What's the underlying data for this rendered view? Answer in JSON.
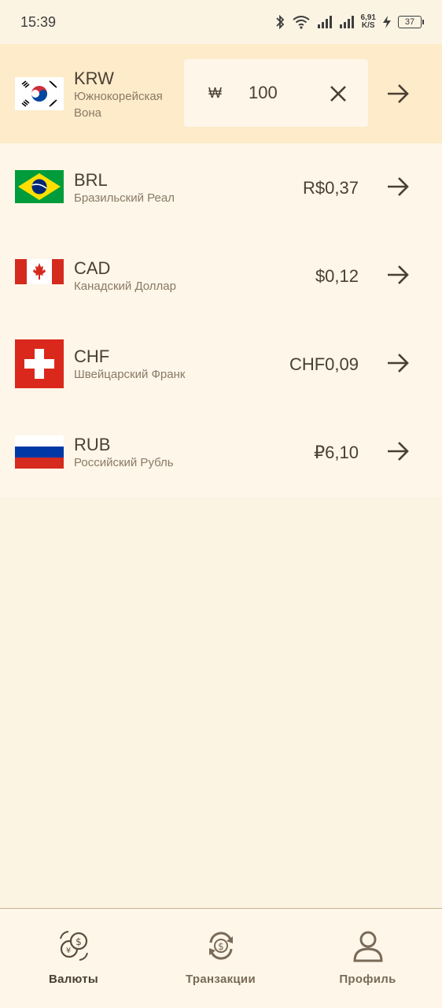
{
  "status_bar": {
    "time": "15:39",
    "network_speed": "6,91",
    "speed_unit": "K/S",
    "battery": "37"
  },
  "base_currency": {
    "code": "KRW",
    "name": "Южнокорейская Вона",
    "symbol": "₩",
    "amount": "100",
    "flag_icon": "south-korea-flag-icon"
  },
  "currencies": [
    {
      "code": "BRL",
      "name": "Бразильский Реал",
      "value": "R$0,37",
      "flag_icon": "brazil-flag-icon"
    },
    {
      "code": "CAD",
      "name": "Канадский Доллар",
      "value": "$0,12",
      "flag_icon": "canada-flag-icon"
    },
    {
      "code": "CHF",
      "name": "Швейцарский Франк",
      "value": "CHF0,09",
      "flag_icon": "switzerland-flag-icon"
    },
    {
      "code": "RUB",
      "name": "Российский Рубль",
      "value": "₽6,10",
      "flag_icon": "russia-flag-icon"
    }
  ],
  "nav": {
    "items": [
      {
        "label": "Валюты",
        "icon": "currency-coins-icon",
        "active": true
      },
      {
        "label": "Транзакции",
        "icon": "exchange-icon",
        "active": false
      },
      {
        "label": "Профиль",
        "icon": "profile-icon",
        "active": false
      }
    ]
  },
  "colors": {
    "background": "#fcf4e3",
    "active_row": "#fdebc9",
    "list_bg": "#fdf6e9",
    "text": "#4a3f33",
    "accent": "#7a6a58"
  }
}
